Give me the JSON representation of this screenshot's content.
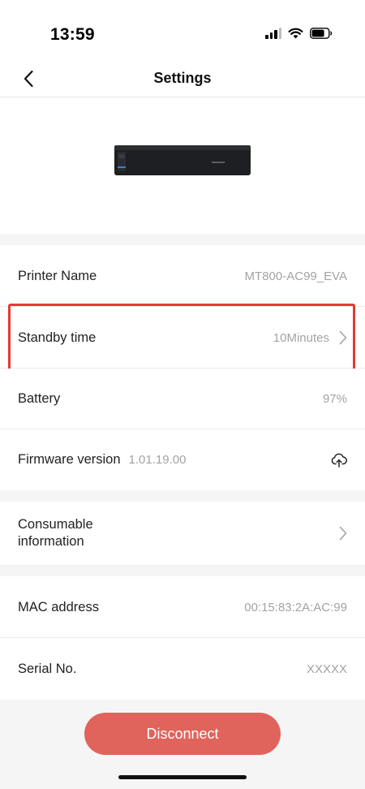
{
  "status_bar": {
    "time": "13:59"
  },
  "header": {
    "title": "Settings"
  },
  "rows": {
    "printer_name": {
      "label": "Printer Name",
      "value": "MT800-AC99_EVA"
    },
    "standby_time": {
      "label": "Standby time",
      "value": "10Minutes"
    },
    "battery": {
      "label": "Battery",
      "value": "97%"
    },
    "firmware": {
      "label": "Firmware version",
      "value": "1.01.19.00"
    },
    "consumable": {
      "label_line1": "Consumable",
      "label_line2": "information"
    },
    "mac": {
      "label": "MAC address",
      "value": "00:15:83:2A:AC:99"
    },
    "serial": {
      "label": "Serial No.",
      "value": "XXXXX"
    }
  },
  "actions": {
    "disconnect_label": "Disconnect"
  },
  "colors": {
    "accent": "#e0645c",
    "highlight": "#e53935",
    "muted_text": "#a3a3a3",
    "section_bg": "#f5f5f5"
  },
  "icons": [
    "back-chevron-icon",
    "chevron-right-icon",
    "cloud-upload-icon",
    "signal-icon",
    "wifi-icon",
    "battery-icon"
  ]
}
